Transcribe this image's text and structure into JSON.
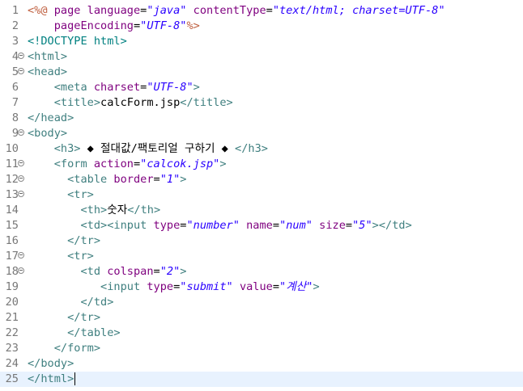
{
  "editor": {
    "colors": {
      "tag": "#3f7f7f",
      "attribute": "#7f007f",
      "value": "#2a00ff",
      "jsp": "#bf5f3f",
      "line_number": "#787878",
      "current_line": "#e8f2fe"
    },
    "current_line": 25,
    "lines": [
      {
        "n": "1",
        "fold": false,
        "tokens": [
          [
            "jsp",
            "<%@ "
          ],
          [
            "attr",
            "page "
          ],
          [
            "attr",
            "language"
          ],
          [
            "text",
            "="
          ],
          [
            "val",
            "\"java\""
          ],
          [
            "text",
            " "
          ],
          [
            "attr",
            "contentType"
          ],
          [
            "text",
            "="
          ],
          [
            "val",
            "\"text/html; charset=UTF-8\""
          ]
        ]
      },
      {
        "n": "2",
        "fold": false,
        "tokens": [
          [
            "text",
            "    "
          ],
          [
            "attr",
            "pageEncoding"
          ],
          [
            "text",
            "="
          ],
          [
            "val",
            "\"UTF-8\""
          ],
          [
            "jsp",
            "%>"
          ]
        ]
      },
      {
        "n": "3",
        "fold": false,
        "tokens": [
          [
            "doctype",
            "<!DOCTYPE html>"
          ]
        ]
      },
      {
        "n": "4",
        "fold": true,
        "tokens": [
          [
            "tag",
            "<html>"
          ]
        ]
      },
      {
        "n": "5",
        "fold": true,
        "tokens": [
          [
            "tag",
            "<head>"
          ]
        ]
      },
      {
        "n": "6",
        "fold": false,
        "tokens": [
          [
            "text",
            "    "
          ],
          [
            "tag",
            "<meta "
          ],
          [
            "attr",
            "charset"
          ],
          [
            "text",
            "="
          ],
          [
            "val",
            "\"UTF-8\""
          ],
          [
            "tag",
            ">"
          ]
        ]
      },
      {
        "n": "7",
        "fold": false,
        "tokens": [
          [
            "text",
            "    "
          ],
          [
            "tag",
            "<title>"
          ],
          [
            "text",
            "calcForm.jsp"
          ],
          [
            "tag",
            "</title>"
          ]
        ]
      },
      {
        "n": "8",
        "fold": false,
        "tokens": [
          [
            "tag",
            "</head>"
          ]
        ]
      },
      {
        "n": "9",
        "fold": true,
        "tokens": [
          [
            "tag",
            "<body>"
          ]
        ]
      },
      {
        "n": "10",
        "fold": false,
        "tokens": [
          [
            "text",
            "    "
          ],
          [
            "tag",
            "<h3>"
          ],
          [
            "text",
            " ◆ 절대값/팩토리얼 구하기 ◆ "
          ],
          [
            "tag",
            "</h3>"
          ]
        ]
      },
      {
        "n": "11",
        "fold": true,
        "tokens": [
          [
            "text",
            "    "
          ],
          [
            "tag",
            "<form "
          ],
          [
            "attr",
            "action"
          ],
          [
            "text",
            "="
          ],
          [
            "val",
            "\"calcok.jsp\""
          ],
          [
            "tag",
            ">"
          ]
        ]
      },
      {
        "n": "12",
        "fold": true,
        "tokens": [
          [
            "text",
            "      "
          ],
          [
            "tag",
            "<table "
          ],
          [
            "attr",
            "border"
          ],
          [
            "text",
            "="
          ],
          [
            "val",
            "\"1\""
          ],
          [
            "tag",
            ">"
          ]
        ]
      },
      {
        "n": "13",
        "fold": true,
        "tokens": [
          [
            "text",
            "      "
          ],
          [
            "tag",
            "<tr>"
          ]
        ]
      },
      {
        "n": "14",
        "fold": false,
        "tokens": [
          [
            "text",
            "        "
          ],
          [
            "tag",
            "<th>"
          ],
          [
            "text",
            "숫자"
          ],
          [
            "tag",
            "</th>"
          ]
        ]
      },
      {
        "n": "15",
        "fold": false,
        "tokens": [
          [
            "text",
            "        "
          ],
          [
            "tag",
            "<td><input "
          ],
          [
            "attr",
            "type"
          ],
          [
            "text",
            "="
          ],
          [
            "val",
            "\"number\""
          ],
          [
            "text",
            " "
          ],
          [
            "attr",
            "name"
          ],
          [
            "text",
            "="
          ],
          [
            "val",
            "\"num\""
          ],
          [
            "text",
            " "
          ],
          [
            "attr",
            "size"
          ],
          [
            "text",
            "="
          ],
          [
            "val",
            "\"5\""
          ],
          [
            "tag",
            "></td>"
          ]
        ]
      },
      {
        "n": "16",
        "fold": false,
        "tokens": [
          [
            "text",
            "      "
          ],
          [
            "tag",
            "</tr>"
          ]
        ]
      },
      {
        "n": "17",
        "fold": true,
        "tokens": [
          [
            "text",
            "      "
          ],
          [
            "tag",
            "<tr>"
          ]
        ]
      },
      {
        "n": "18",
        "fold": true,
        "tokens": [
          [
            "text",
            "        "
          ],
          [
            "tag",
            "<td "
          ],
          [
            "attr",
            "colspan"
          ],
          [
            "text",
            "="
          ],
          [
            "val",
            "\"2\""
          ],
          [
            "tag",
            ">"
          ]
        ]
      },
      {
        "n": "19",
        "fold": false,
        "tokens": [
          [
            "text",
            "           "
          ],
          [
            "tag",
            "<input "
          ],
          [
            "attr",
            "type"
          ],
          [
            "text",
            "="
          ],
          [
            "val",
            "\"submit\""
          ],
          [
            "text",
            " "
          ],
          [
            "attr",
            "value"
          ],
          [
            "text",
            "="
          ],
          [
            "val",
            "\"계산\""
          ],
          [
            "tag",
            ">"
          ]
        ]
      },
      {
        "n": "20",
        "fold": false,
        "tokens": [
          [
            "text",
            "        "
          ],
          [
            "tag",
            "</td>"
          ]
        ]
      },
      {
        "n": "21",
        "fold": false,
        "tokens": [
          [
            "text",
            "      "
          ],
          [
            "tag",
            "</tr>"
          ]
        ]
      },
      {
        "n": "22",
        "fold": false,
        "tokens": [
          [
            "text",
            "      "
          ],
          [
            "tag",
            "</table>"
          ]
        ]
      },
      {
        "n": "23",
        "fold": false,
        "tokens": [
          [
            "text",
            "    "
          ],
          [
            "tag",
            "</form>"
          ]
        ]
      },
      {
        "n": "24",
        "fold": false,
        "tokens": [
          [
            "tag",
            "</body>"
          ]
        ]
      },
      {
        "n": "25",
        "fold": false,
        "tokens": [
          [
            "tag",
            "</html>"
          ]
        ]
      }
    ]
  }
}
